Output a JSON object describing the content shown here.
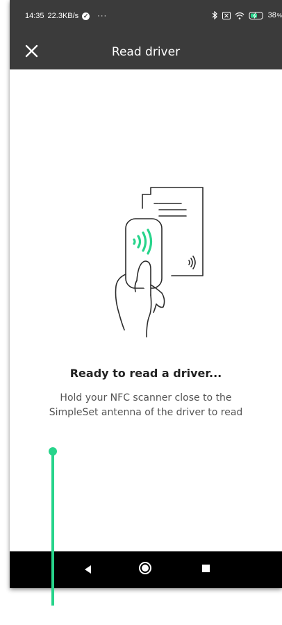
{
  "statusbar": {
    "time": "14:35",
    "speed": "22.3KB/s",
    "dots": "···",
    "battery": "38",
    "battery_unit": "%",
    "icons": [
      "bluetooth-icon",
      "sim-icon",
      "wifi-icon",
      "battery-charging-icon"
    ]
  },
  "toolbar": {
    "title": "Read driver",
    "close_icon": "close-icon"
  },
  "main": {
    "heading": "Ready to read a driver...",
    "description_line1": "Hold your NFC scanner close to the",
    "description_line2": "SimpleSet antenna of the driver to read",
    "illustration": "nfc-scanner-hand-icon",
    "accent_color": "#27d48b"
  },
  "navbar": {
    "icons": [
      "nav-back-icon",
      "nav-home-icon",
      "nav-recent-icon"
    ]
  },
  "colors": {
    "bar": "#3b3b3b",
    "nav": "#000000",
    "highlight": "#27d48b"
  }
}
